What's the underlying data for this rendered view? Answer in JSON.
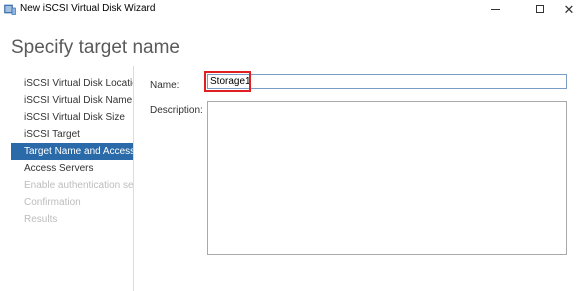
{
  "window": {
    "title": "New iSCSI Virtual Disk Wizard",
    "icon": "server-disk-icon",
    "controls": [
      "minimize-icon",
      "maximize-icon",
      "close-icon"
    ]
  },
  "page": {
    "heading": "Specify target name"
  },
  "nav": {
    "items": [
      {
        "label": "iSCSI Virtual Disk Location",
        "state": "normal"
      },
      {
        "label": "iSCSI Virtual Disk Name",
        "state": "normal"
      },
      {
        "label": "iSCSI Virtual Disk Size",
        "state": "normal"
      },
      {
        "label": "iSCSI Target",
        "state": "normal"
      },
      {
        "label": "Target Name and Access",
        "state": "active"
      },
      {
        "label": "Access Servers",
        "state": "normal"
      },
      {
        "label": "Enable authentication ser...",
        "state": "disabled"
      },
      {
        "label": "Confirmation",
        "state": "disabled"
      },
      {
        "label": "Results",
        "state": "disabled"
      }
    ]
  },
  "form": {
    "name_label": "Name:",
    "name_value": "Storage1",
    "description_label": "Description:",
    "description_value": ""
  },
  "colors": {
    "active_nav": "#2a6aa8",
    "highlight": "#e02020",
    "heading": "#5a5a5a"
  }
}
